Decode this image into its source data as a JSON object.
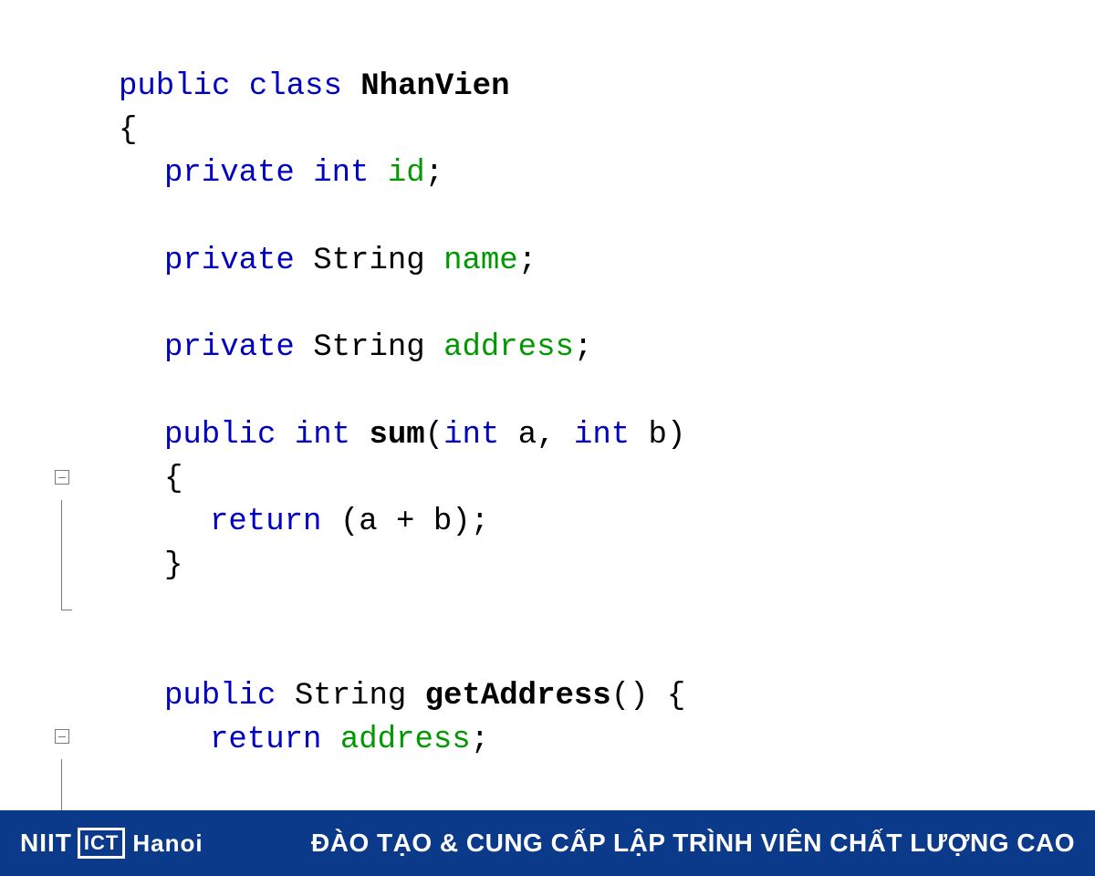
{
  "code": {
    "l1_kw1": "public",
    "l1_kw2": "class",
    "l1_name": "NhanVien",
    "l2_brace": "{",
    "l3_kw1": "private",
    "l3_kw2": "int",
    "l3_id": "id",
    "l3_semi": ";",
    "l4_kw1": "private",
    "l4_type": "String",
    "l4_id": "name",
    "l4_semi": ";",
    "l5_kw1": "private",
    "l5_type": "String",
    "l5_id": "address",
    "l5_semi": ";",
    "l6_kw1": "public",
    "l6_kw2": "int",
    "l6_name": "sum",
    "l6_paren1": "(",
    "l6_p1_kw": "int",
    "l6_p1_id": "a",
    "l6_comma": ", ",
    "l6_p2_kw": "int",
    "l6_p2_id": "b",
    "l6_paren2": ")",
    "l7_brace": "{",
    "l8_kw": "return",
    "l8_expr": " (a + b);",
    "l9_brace": "}",
    "l10_kw1": "public",
    "l10_type": "String",
    "l10_name": "getAddress",
    "l10_rest": "() {",
    "l11_kw": "return",
    "l11_sp": " ",
    "l11_id": "address",
    "l11_semi": ";"
  },
  "footer": {
    "brand_niit": "NIIT",
    "brand_ict": "ICT",
    "brand_hanoi": "Hanoi",
    "slogan": "ĐÀO TẠO & CUNG CẤP LẬP TRÌNH VIÊN CHẤT LƯỢNG CAO"
  }
}
